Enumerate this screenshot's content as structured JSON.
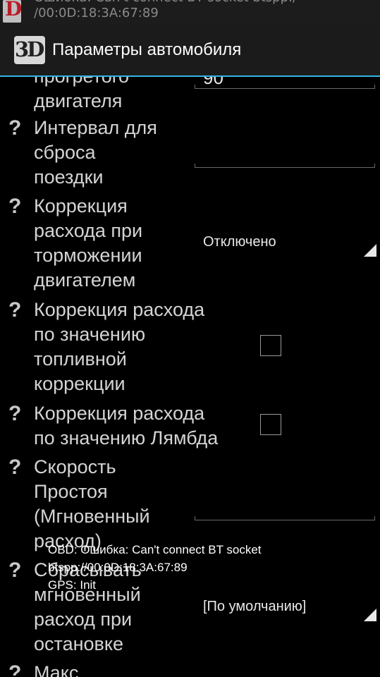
{
  "status_bar": {
    "app_icon_letter": "D",
    "notification_line1": "Ошибка: Can't connect BT socket btspp:/",
    "notification_line2": "/00:0D:18:3A:67:89"
  },
  "action_bar": {
    "logo_text": "3D",
    "title": "Параметры автомобиля",
    "accent_color": "#33b5e5"
  },
  "settings": [
    {
      "label_lines": [
        "прогретого",
        "двигателя"
      ],
      "control": "text",
      "value": "90"
    },
    {
      "label_lines": [
        "Интервал для",
        "сброса",
        "поездки"
      ],
      "control": "text",
      "value": ""
    },
    {
      "label_lines": [
        "Коррекция",
        "расхода при",
        "торможении",
        "двигателем"
      ],
      "control": "spinner",
      "value": "Отключено"
    },
    {
      "label_lines": [
        "Коррекция расхода",
        "по значению",
        "топливной",
        "коррекции"
      ],
      "control": "checkbox",
      "checked": false
    },
    {
      "label_lines": [
        "Коррекция расхода",
        "по значению Лямбда"
      ],
      "control": "checkbox",
      "checked": false
    },
    {
      "label_lines": [
        "Скорость",
        "Простоя",
        "(Мгновенный",
        "расход)"
      ],
      "control": "text",
      "value": ""
    },
    {
      "label_lines": [
        "Сбрасывать",
        "мгновенный",
        "расход при",
        "остановке"
      ],
      "control": "spinner",
      "value": "[По умолчанию]"
    },
    {
      "label_lines": [
        "Макс"
      ],
      "control": "none"
    }
  ],
  "help_glyph": "?",
  "overlay": {
    "line1": "OBD: Ошибка: Can't connect BT socket",
    "line2": "btspp://00:0D:18:3A:67:89",
    "line3": "GPS: Init"
  }
}
